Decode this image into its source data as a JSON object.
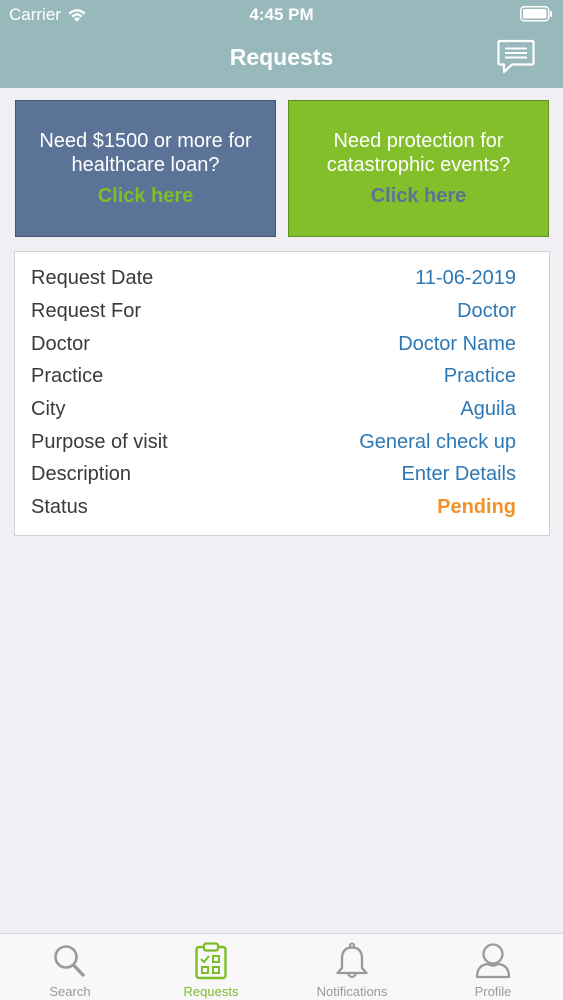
{
  "status_bar": {
    "carrier": "Carrier",
    "time": "4:45 PM"
  },
  "nav": {
    "title": "Requests",
    "right_icon": "chat-icon"
  },
  "banners": [
    {
      "text": "Need $1500 or more for healthcare loan?",
      "cta": "Click here",
      "color": "#5b7397",
      "cta_color": "#7cbd2a"
    },
    {
      "text": "Need protection for catastrophic events?",
      "cta": "Click here",
      "color": "#82bf2a",
      "cta_color": "#5e7393"
    }
  ],
  "request": {
    "rows": [
      {
        "label": "Request Date",
        "value": "11-06-2019"
      },
      {
        "label": "Request For",
        "value": "Doctor"
      },
      {
        "label": "Doctor",
        "value": "Doctor Name"
      },
      {
        "label": "Practice",
        "value": "Practice"
      },
      {
        "label": "City",
        "value": "Aguila"
      },
      {
        "label": "Purpose of visit",
        "value": "General check up"
      },
      {
        "label": "Description",
        "value": "Enter Details"
      },
      {
        "label": "Status",
        "value": "Pending"
      }
    ],
    "value_color": "#2d78b4",
    "status_color": "#f0922c"
  },
  "tabs": [
    {
      "label": "Search",
      "icon": "search-icon",
      "active": false
    },
    {
      "label": "Requests",
      "icon": "clipboard-icon",
      "active": true
    },
    {
      "label": "Notifications",
      "icon": "bell-icon",
      "active": false
    },
    {
      "label": "Profile",
      "icon": "user-icon",
      "active": false
    }
  ],
  "colors": {
    "header": "#97b9bc",
    "accent": "#7cbd2a"
  }
}
